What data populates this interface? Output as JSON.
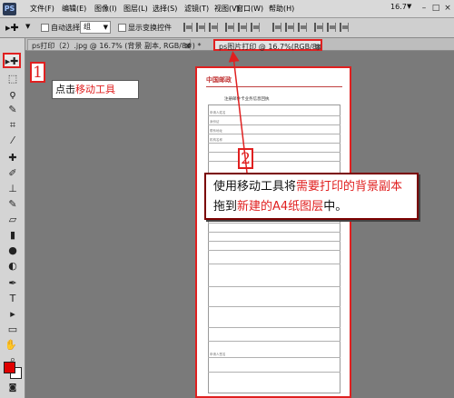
{
  "app": {
    "logo": "PS"
  },
  "menubar": {
    "items": [
      "文件(F)",
      "编辑(E)",
      "图像(I)",
      "图层(L)",
      "选择(S)",
      "滤镜(T)",
      "视图(V)",
      "窗口(W)",
      "帮助(H)"
    ],
    "zoom": "16.7"
  },
  "options_bar": {
    "auto_select_label": "自动选择:",
    "auto_select_value": "组",
    "show_transform_label": "显示变换控件"
  },
  "tabs": [
    {
      "label": "ps打印（2）.jpg @ 16.7% (背景 副本, RGB/8#) *",
      "active": false
    },
    {
      "label": "ps图片打印 @ 16.7%(RGB/8)",
      "active": true
    }
  ],
  "document": {
    "logo_text": "中国邮政",
    "title": "注册邮件卡业务信息回执",
    "row_labels": [
      "申请人姓名",
      "身份证",
      "联系地址",
      "机构名称",
      "申请人签名"
    ]
  },
  "callouts": {
    "step1_number": "1",
    "step1_text_plain": "点击",
    "step1_text_red": "移动工具",
    "step2_number": "2",
    "step2_part1": "使用移动工具将",
    "step2_part2_red": "需要打印的背景副本",
    "step2_part3": "拖到",
    "step2_part4_red": "新建的A4纸图层",
    "step2_part5": "中。"
  },
  "colors": {
    "foreground": "#e00000",
    "background": "#ffffff",
    "highlight": "#e02020"
  }
}
